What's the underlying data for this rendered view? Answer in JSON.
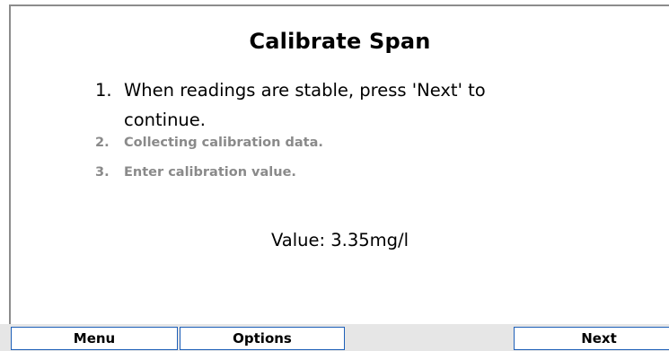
{
  "screen": {
    "title": "Calibrate Span",
    "steps": [
      {
        "number": "1.",
        "text": "When readings are stable, press 'Next' to continue.",
        "state": "active"
      },
      {
        "number": "2.",
        "text": "Collecting calibration data.",
        "state": "inactive"
      },
      {
        "number": "3.",
        "text": "Enter calibration value.",
        "state": "inactive"
      }
    ],
    "value_text": "Value: 3.35mg/l"
  },
  "softkeys": {
    "menu": "Menu",
    "options": "Options",
    "next": "Next"
  },
  "colors": {
    "inactive_text": "#8a8a8a",
    "softkey_border": "#1d5fb8",
    "softkey_bar": "#e6e6e6"
  }
}
